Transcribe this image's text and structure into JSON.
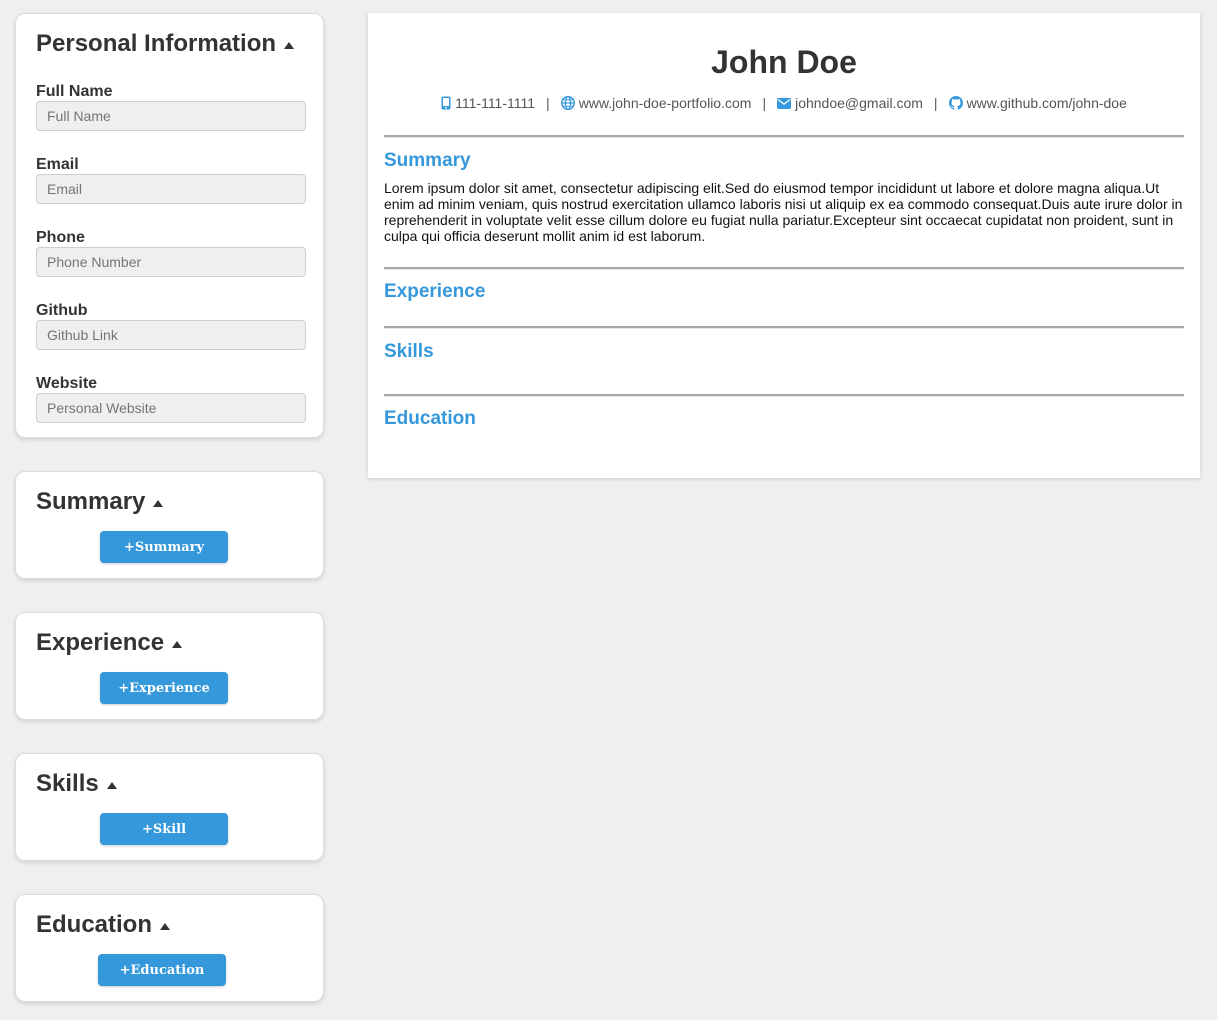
{
  "colors": {
    "accent": "#3498db",
    "page_background": "#efefef",
    "panel_background": "#ffffff",
    "text": "#333333"
  },
  "personal_info": {
    "title": "Personal Information",
    "fields": [
      {
        "label": "Full Name",
        "placeholder": "Full Name",
        "value": ""
      },
      {
        "label": "Email",
        "placeholder": "Email",
        "value": ""
      },
      {
        "label": "Phone",
        "placeholder": "Phone Number",
        "value": ""
      },
      {
        "label": "Github",
        "placeholder": "Github Link",
        "value": ""
      },
      {
        "label": "Website",
        "placeholder": "Personal Website",
        "value": ""
      }
    ]
  },
  "editor_sections": [
    {
      "title": "Summary",
      "button_label": "+Summary"
    },
    {
      "title": "Experience",
      "button_label": "+Experience"
    },
    {
      "title": "Skills",
      "button_label": "+Skill"
    },
    {
      "title": "Education",
      "button_label": "+Education"
    }
  ],
  "resume": {
    "name": "John Doe",
    "contacts": [
      {
        "icon": "mobile-phone-icon",
        "text": "111-111-1111"
      },
      {
        "icon": "globe-icon",
        "text": "www.john-doe-portfolio.com"
      },
      {
        "icon": "envelope-icon",
        "text": "johndoe@gmail.com"
      },
      {
        "icon": "github-icon",
        "text": "www.github.com/john-doe"
      }
    ],
    "separator": "|",
    "sections": {
      "summary": {
        "heading": "Summary",
        "text": "Lorem ipsum dolor sit amet, consectetur adipiscing elit.Sed do eiusmod tempor incididunt ut labore et dolore magna aliqua.Ut enim ad minim veniam, quis nostrud exercitation ullamco laboris nisi ut aliquip ex ea commodo consequat.Duis aute irure dolor in reprehenderit in voluptate velit esse cillum dolore eu fugiat nulla pariatur.Excepteur sint occaecat cupidatat non proident, sunt in culpa qui officia deserunt mollit anim id est laborum."
      },
      "experience": {
        "heading": "Experience"
      },
      "skills": {
        "heading": "Skills"
      },
      "education": {
        "heading": "Education"
      }
    }
  }
}
